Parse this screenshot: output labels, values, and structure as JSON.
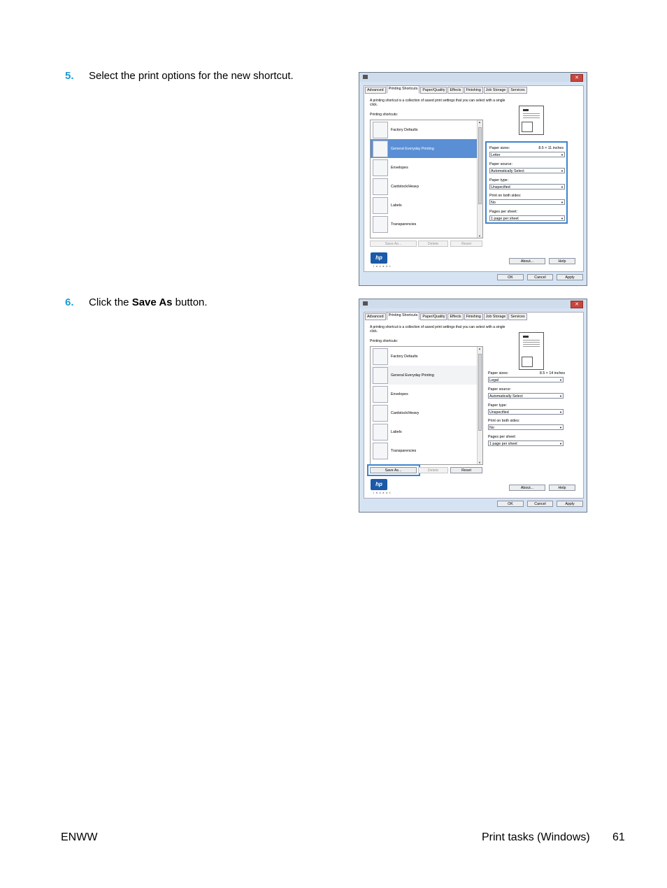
{
  "steps": [
    {
      "num": "5.",
      "text": "Select the print options for the new shortcut."
    },
    {
      "num": "6.",
      "pre": "Click the ",
      "bold": "Save As",
      "post": " button."
    }
  ],
  "footer": {
    "left": "ENWW",
    "section": "Print tasks (Windows)",
    "page": "61"
  },
  "dialog": {
    "close_glyph": "✕",
    "tabs": [
      "Advanced",
      "Printing Shortcuts",
      "Paper/Quality",
      "Effects",
      "Finishing",
      "Job Storage",
      "Services"
    ],
    "description": "A printing shortcut is a collection of saved print settings that you can select with a single click.",
    "shortcuts_label": "Printing shortcuts:",
    "shortcuts": [
      "Factory Defaults",
      "General Everyday Printing",
      "Envelopes",
      "Cardstock/Heavy",
      "Labels",
      "Transparencies"
    ],
    "buttons": {
      "save_as": "Save As...",
      "delete": "Delete",
      "reset": "Reset",
      "about": "About...",
      "help": "Help",
      "ok": "OK",
      "cancel": "Cancel",
      "apply": "Apply"
    },
    "option_labels": {
      "paper_size": "Paper sizes:",
      "paper_source": "Paper source:",
      "paper_type": "Paper type:",
      "duplex": "Print on both sides:",
      "pages_per_sheet": "Pages per sheet:"
    },
    "brand": "hp",
    "brand_sub": "invent"
  },
  "dialog1": {
    "paper_size_dims": "8.5 × 11 inches",
    "paper_size": "Letter",
    "paper_source": "Automatically Select",
    "paper_type": "Unspecified",
    "duplex": "No",
    "pages_per_sheet": "1 page per sheet"
  },
  "dialog2": {
    "paper_size_dims": "8.5 × 14 inches",
    "paper_size": "Legal",
    "paper_source": "Automatically Select",
    "paper_type": "Unspecified",
    "duplex": "No",
    "pages_per_sheet": "1 page per sheet"
  }
}
